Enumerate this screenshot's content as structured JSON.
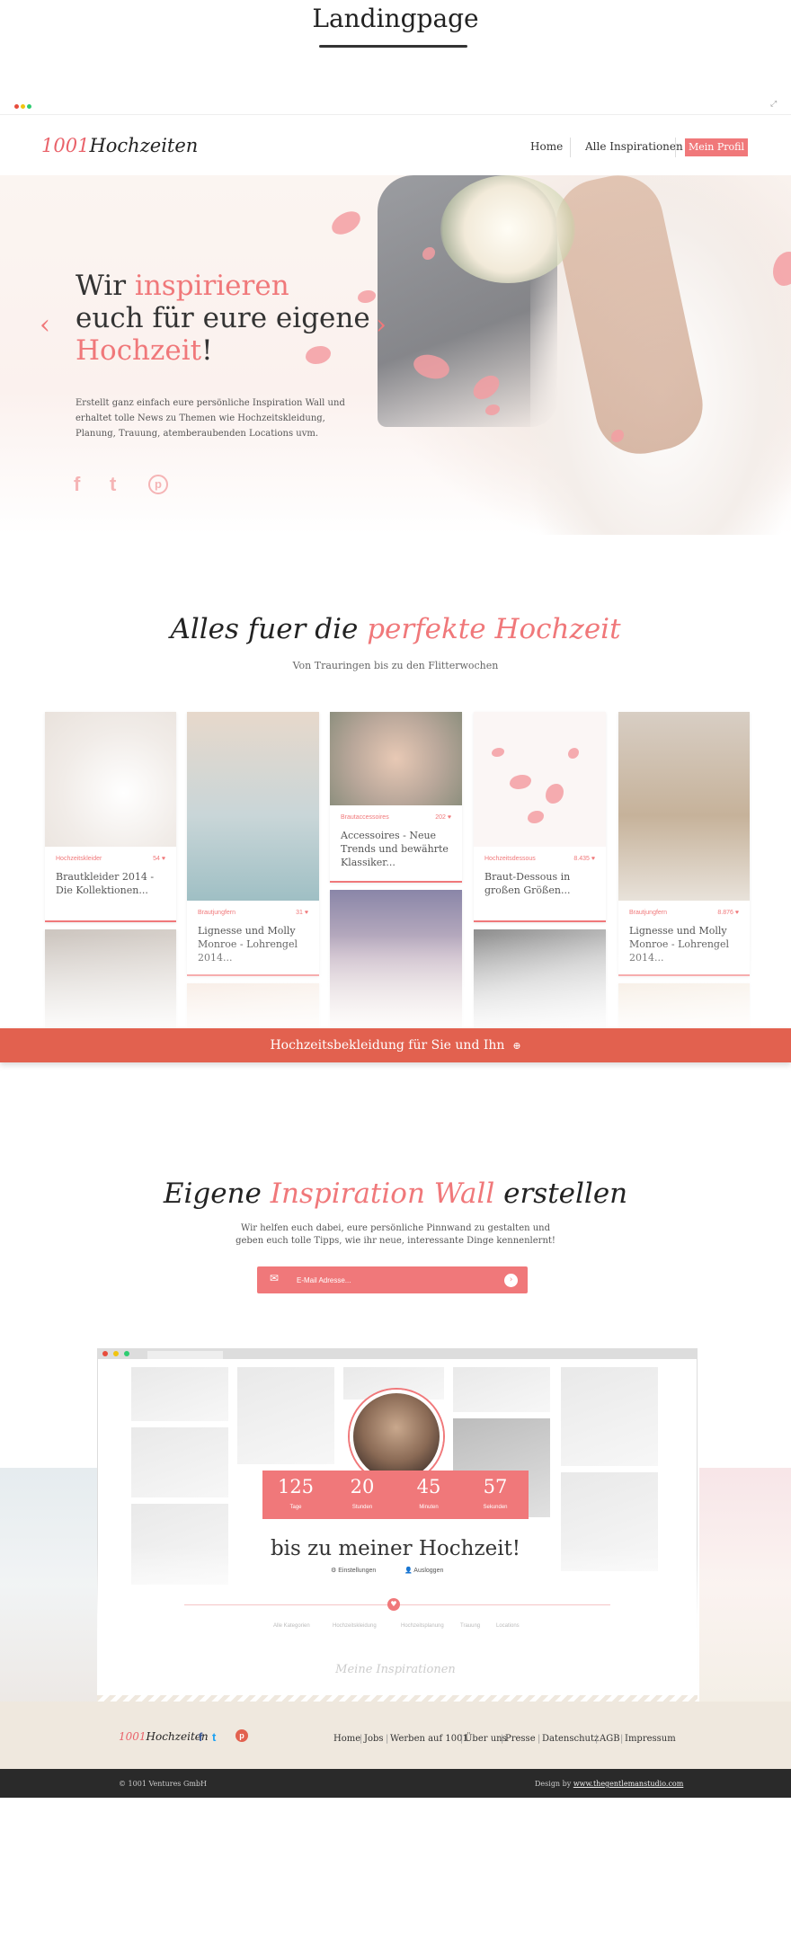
{
  "page_title": "Landingpage",
  "nav": {
    "logo_number": "1001",
    "logo_text": "Hochzeiten",
    "home": "Home",
    "inspirations": "Alle Inspirationen",
    "profile": "Mein Profil"
  },
  "hero": {
    "line1_a": "Wir ",
    "line1_b": "inspirieren",
    "line2": "euch für eure eigene",
    "line3_a": "Hochzeit",
    "line3_b": "!",
    "text": "Erstellt ganz einfach eure persönliche Inspiration Wall und erhaltet tolle News zu Themen wie Hochzeitskleidung, Planung, Trauung, atemberaubenden Locations uvm.",
    "arrow_left": "‹",
    "arrow_right": "›",
    "social": [
      "f",
      "t",
      "p"
    ]
  },
  "section2": {
    "title_a": "Alles fuer die ",
    "title_b": "perfekte Hochzeit",
    "subtitle": "Von Trauringen bis zu den Flitterwochen"
  },
  "cards": [
    {
      "category": "Hochzeitskleider",
      "count": "54",
      "title": "Brautkleider 2014 - Die Kollektionen..."
    },
    {
      "category": "Brautjungfern",
      "count": "31",
      "title": "Lignesse und Molly Monroe - Lohrengel 2014..."
    },
    {
      "category": "Brautaccessoires",
      "count": "202",
      "title": "Accessoires - Neue Trends und bewährte Klassiker..."
    },
    {
      "category": "Hochzeitsdessous",
      "count": "8.435",
      "title": "Braut-Dessous in großen Größen..."
    },
    {
      "category": "Brautjungfern",
      "count": "8.876",
      "title": "Lignesse und Molly Monroe - Lohrengel 2014..."
    }
  ],
  "banner": {
    "label": "Hochzeitsbekleidung für Sie und Ihn",
    "icon": "⊕"
  },
  "section3": {
    "title_a": "Eigene ",
    "title_b": "Inspiration Wall",
    "title_c": " erstellen",
    "subtitle": "Wir helfen euch dabei, eure persönliche Pinnwand zu gestalten und geben euch tolle Tipps, wie ihr neue, interessante Dinge kennenlernt!",
    "email_placeholder": "E-Mail Adresse...",
    "email_icon": "✉",
    "submit_icon": "›"
  },
  "countdown": [
    {
      "value": "125",
      "label": "Tage"
    },
    {
      "value": "20",
      "label": "Stunden"
    },
    {
      "value": "45",
      "label": "Minuten"
    },
    {
      "value": "57",
      "label": "Sekunden"
    }
  ],
  "mock": {
    "until": "bis zu meiner Hochzeit!",
    "settings": "Einstellungen",
    "logout": "Ausloggen",
    "heart": "♥",
    "tabs": [
      "Alle Kategorien",
      "Hochzeitskleidung",
      "Hochzeitsplanung",
      "Trauung",
      "Locations"
    ],
    "inspirations": "Meine Inspirationen"
  },
  "footer": {
    "logo_number": "1001",
    "logo_text": "Hochzeiten",
    "links": [
      "Home",
      "Jobs",
      "Werben auf 1001",
      "Über uns",
      "Presse",
      "Datenschutz",
      "AGB",
      "Impressum"
    ],
    "copyright": "© 1001 Ventures GmbH",
    "design_prefix": "Design by ",
    "design_link": "www.thegentlemanstudio.com"
  },
  "colors": {
    "accent": "#f0787a",
    "banner": "#e2614f",
    "footer_bg": "#efe8de",
    "bottom_bar": "#2a2a2a"
  }
}
